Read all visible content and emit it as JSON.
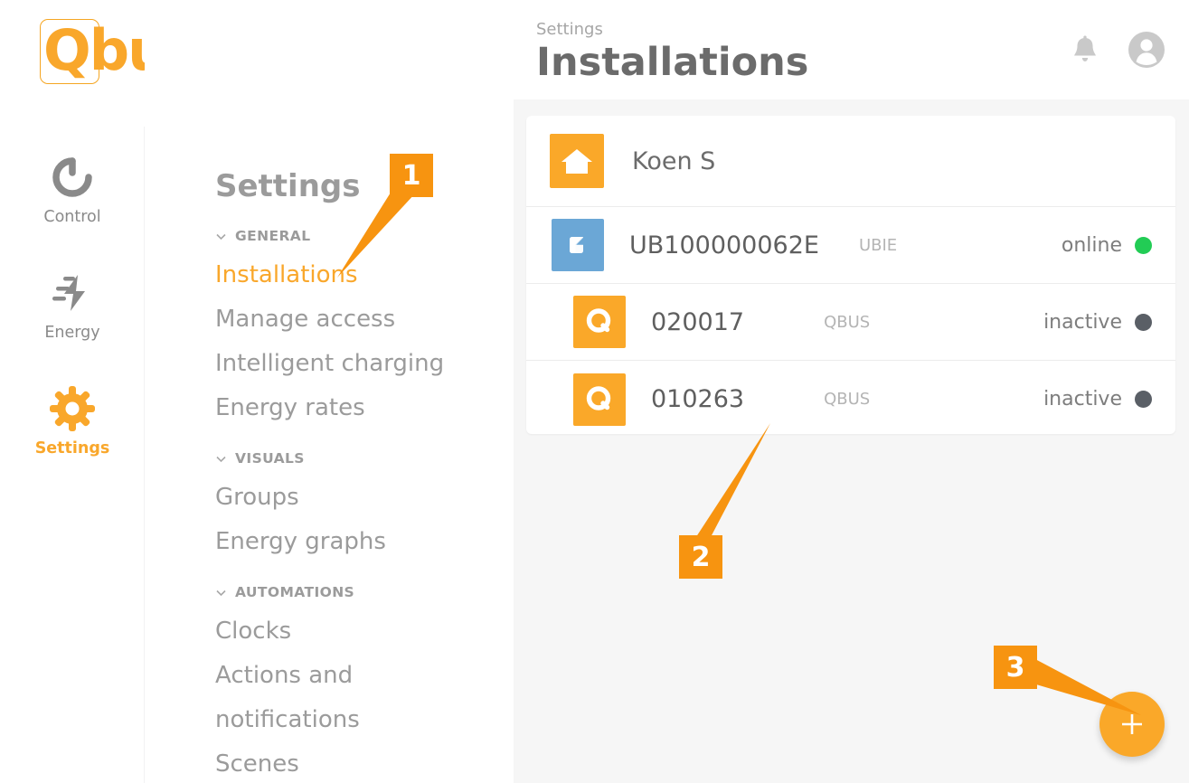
{
  "brand": {
    "logo_text": "Qbus",
    "accent": "#f9a72b"
  },
  "rail": {
    "items": [
      {
        "label": "Control",
        "icon": "control-circle-icon",
        "active": false
      },
      {
        "label": "Energy",
        "icon": "energy-bolt-icon",
        "active": false
      },
      {
        "label": "Settings",
        "icon": "gear-icon",
        "active": true
      }
    ]
  },
  "menu": {
    "title": "Settings",
    "sections": [
      {
        "label": "GENERAL",
        "items": [
          {
            "label": "Installations",
            "active": true
          },
          {
            "label": "Manage access",
            "active": false
          },
          {
            "label": "Intelligent charging",
            "active": false
          },
          {
            "label": "Energy rates",
            "active": false
          }
        ]
      },
      {
        "label": "VISUALS",
        "items": [
          {
            "label": "Groups",
            "active": false
          },
          {
            "label": "Energy graphs",
            "active": false
          }
        ]
      },
      {
        "label": "AUTOMATIONS",
        "items": [
          {
            "label": "Clocks",
            "active": false
          },
          {
            "label": "Actions and\nnotifications",
            "active": false
          },
          {
            "label": "Scenes",
            "active": false
          }
        ]
      }
    ]
  },
  "header": {
    "breadcrumb": "Settings",
    "title": "Installations",
    "bell_icon": "bell-icon",
    "avatar_icon": "user-avatar-icon"
  },
  "installations": {
    "group": {
      "name": "Koen S",
      "icon": "house-icon"
    },
    "devices": [
      {
        "name": "UB100000062E",
        "type": "UBIE",
        "status": "online",
        "status_color": "#22cc55",
        "icon": "ubie-icon",
        "tile_color": "#6ba7d6"
      },
      {
        "name": "020017",
        "type": "QBUS",
        "status": "inactive",
        "status_color": "#5a5f66",
        "icon": "qbus-q-icon",
        "tile_color": "#faa829"
      },
      {
        "name": "010263",
        "type": "QBUS",
        "status": "inactive",
        "status_color": "#5a5f66",
        "icon": "qbus-q-icon",
        "tile_color": "#faa829"
      }
    ]
  },
  "fab": {
    "label": "+",
    "icon": "plus-icon"
  },
  "callouts": [
    {
      "number": "1"
    },
    {
      "number": "2"
    },
    {
      "number": "3"
    }
  ]
}
